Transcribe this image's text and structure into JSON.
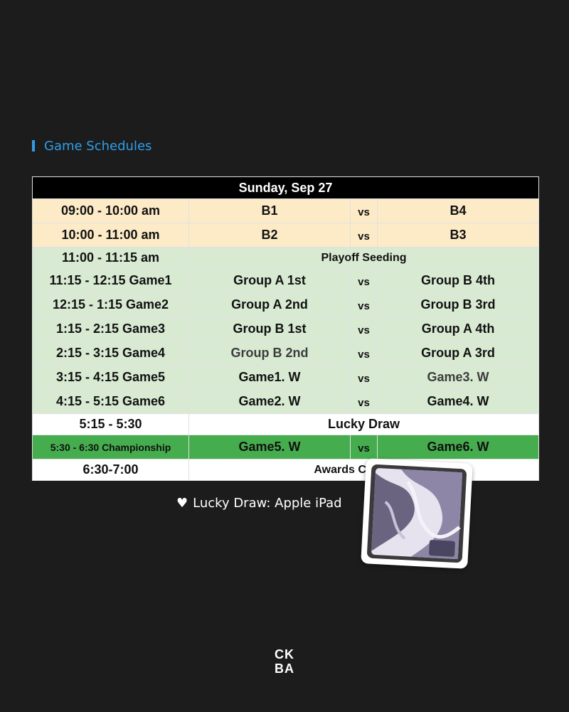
{
  "section": {
    "title": "Game Schedules"
  },
  "schedule": {
    "date": "Sunday, Sep 27",
    "rows": [
      {
        "time": "09:00 - 10:00 am",
        "team1": "B1",
        "vs": "vs",
        "team2": "B4"
      },
      {
        "time": "10:00 - 11:00 am",
        "team1": "B2",
        "vs": "vs",
        "team2": "B3"
      },
      {
        "time": "11:00 - 11:15 am",
        "event": "Playoff Seeding"
      },
      {
        "time": "11:15 - 12:15  Game1",
        "team1": "Group A 1st",
        "vs": "vs",
        "team2": "Group B 4th"
      },
      {
        "time": "12:15 - 1:15  Game2",
        "team1": "Group A 2nd",
        "vs": "vs",
        "team2": "Group B 3rd"
      },
      {
        "time": "1:15 - 2:15  Game3",
        "team1": "Group B 1st",
        "vs": "vs",
        "team2": "Group A 4th"
      },
      {
        "time": "2:15 - 3:15  Game4",
        "team1": "Group B 2nd",
        "vs": "vs",
        "team2": "Group A 3rd"
      },
      {
        "time": "3:15 - 4:15  Game5",
        "team1": "Game1. W",
        "vs": "vs",
        "team2": "Game3. W"
      },
      {
        "time": "4:15 - 5:15  Game6",
        "team1": "Game2. W",
        "vs": "vs",
        "team2": "Game4. W"
      },
      {
        "time": "5:15 - 5:30",
        "event": "Lucky Draw"
      },
      {
        "time": "5:30 - 6:30 Championship",
        "team1": "Game5. W",
        "vs": "vs",
        "team2": "Game6. W"
      },
      {
        "time": "6:30-7:00",
        "event": "Awards Ceremony"
      }
    ]
  },
  "note": {
    "icon": "heart-icon",
    "text": "Lucky Draw: Apple iPad"
  },
  "logo": {
    "line1": "CK",
    "line2": "BA"
  },
  "colors": {
    "accent": "#2f9ee8",
    "beige": "#fdebc8",
    "mint": "#d9ead3",
    "championship": "#45ad4e",
    "background": "#1c1c1c"
  }
}
